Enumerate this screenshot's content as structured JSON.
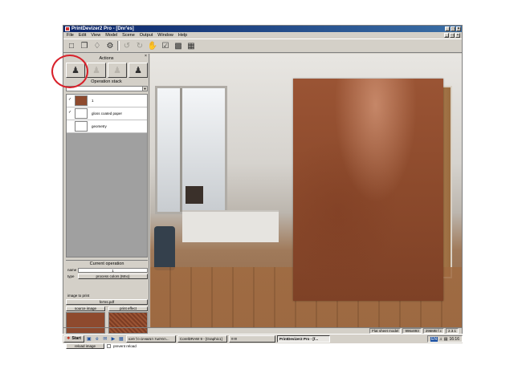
{
  "window": {
    "title": "PrintDevizer2 Pro - [Dnr'es]",
    "controls": [
      "_",
      "□",
      "×"
    ]
  },
  "menu": [
    "File",
    "Edit",
    "View",
    "Model",
    "Scene",
    "Output",
    "Window",
    "Help"
  ],
  "toolbar": {
    "icons": [
      "new-icon",
      "open-icon",
      "bear-icon",
      "settings-icon",
      "rotate-icon",
      "rotate-right-icon",
      "hand-icon",
      "check-icon",
      "camera-icon",
      "film-icon"
    ]
  },
  "panel": {
    "actions_title": "Actions",
    "operation_stack_title": "Operation stack",
    "stack_items": [
      {
        "label": "1",
        "checked": true
      },
      {
        "label": "gloss coated paper",
        "checked": true
      },
      {
        "label": "geometry",
        "checked": false
      }
    ],
    "current_operation_title": "Current operation",
    "name_key": "name",
    "name_value": "1",
    "type_key": "type",
    "type_value": "process colors (Mno)",
    "image_to_print_label": "image to print",
    "file_button": "fer'es.pdf",
    "source_image_label": "source image",
    "print_effect_label": "print effect",
    "reload_button": "reload image",
    "prevent_reload_label": "prevent reload"
  },
  "status": {
    "model": "Flat sheet model",
    "size": "996x893",
    "memory": "296MB f.c",
    "version": "2.3.1"
  },
  "taskbar": {
    "start": "Start",
    "tasks": [
      "הפתעת המשאים כל פוטו...",
      "CorelDRAW 9 - [Graphic1]",
      "!!!!!!",
      "PrintDevizer2 Pro - [f..."
    ],
    "tray_lang": "EN",
    "clock": "16:16"
  },
  "colors": {
    "highlight_circle": "#d8202a",
    "leather": "#8c4a2c",
    "title_bar": "#0a246a"
  }
}
